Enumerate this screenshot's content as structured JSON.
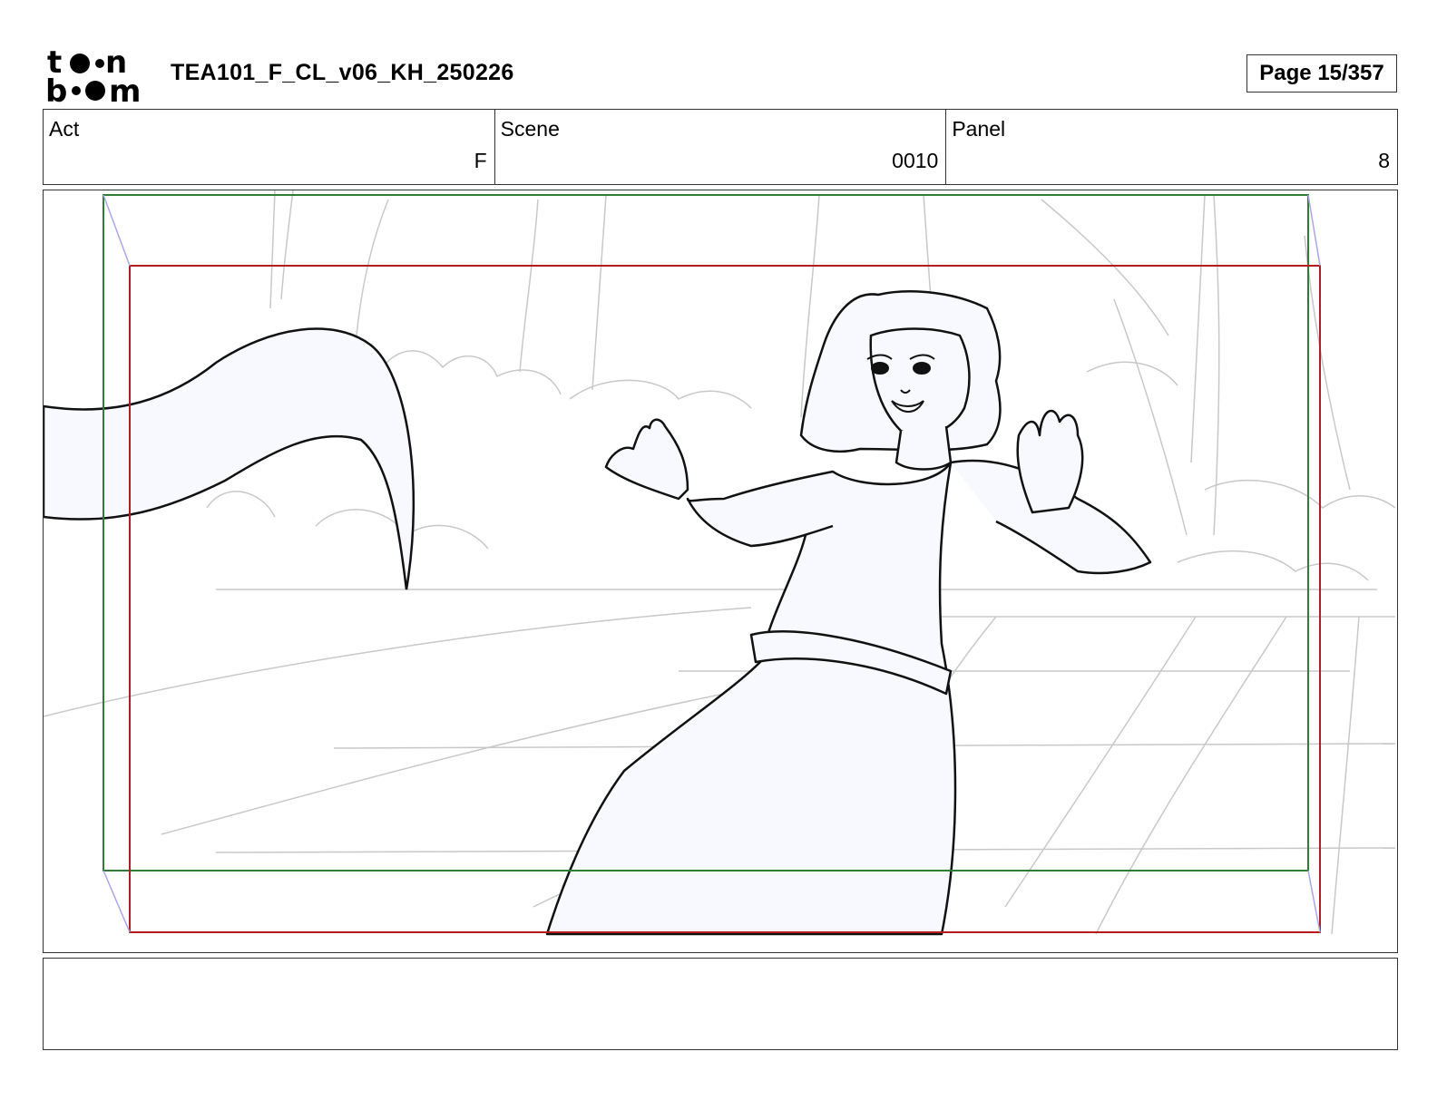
{
  "header": {
    "logo_text": "toon boom",
    "document_title": "TEA101_F_CL_v06_KH_250226",
    "page_label": "Page 15/357"
  },
  "info": {
    "act_label": "Act",
    "act_value": "F",
    "scene_label": "Scene",
    "scene_value": "0010",
    "panel_label": "Panel",
    "panel_value": "8"
  },
  "panel": {
    "content": "storyboard-sketch",
    "camera_frame_colors": {
      "start": "#2e7d32",
      "end": "#b71c1c"
    }
  },
  "dialogue": {
    "text": ""
  }
}
